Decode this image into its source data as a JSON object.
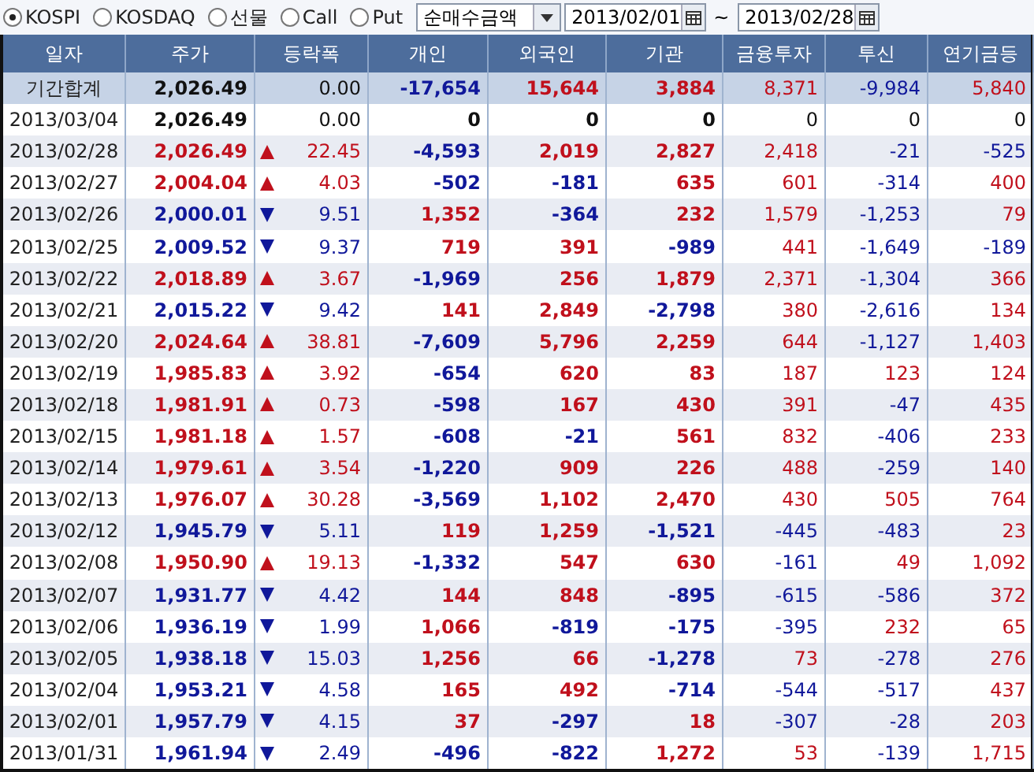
{
  "market_options": [
    {
      "label": "KOSPI",
      "selected": true
    },
    {
      "label": "KOSDAQ",
      "selected": false
    },
    {
      "label": "선물",
      "selected": false
    },
    {
      "label": "Call",
      "selected": false
    },
    {
      "label": "Put",
      "selected": false
    }
  ],
  "measure_select": {
    "value": "순매수금액"
  },
  "date_from": "2013/02/01",
  "range_sep": "~",
  "date_to": "2013/02/28",
  "table": {
    "columns": [
      "일자",
      "주가",
      "등락폭",
      "개인",
      "외국인",
      "기관",
      "금융투자",
      "투신",
      "연기금등"
    ],
    "rows": [
      {
        "date": "기간합계",
        "price": "2,026.49",
        "rising": false,
        "falling": false,
        "change": "0.00",
        "values": [
          "-17,654",
          "15,644",
          "3,884",
          "8,371",
          "-9,984",
          "5,840"
        ],
        "kind": "total"
      },
      {
        "date": "2013/03/04",
        "price": "2,026.49",
        "rising": false,
        "falling": false,
        "change": "0.00",
        "values": [
          "0",
          "0",
          "0",
          "0",
          "0",
          "0"
        ],
        "kind": "day"
      },
      {
        "date": "2013/02/28",
        "price": "2,026.49",
        "rising": true,
        "falling": false,
        "change": "22.45",
        "values": [
          "-4,593",
          "2,019",
          "2,827",
          "2,418",
          "-21",
          "-525"
        ],
        "kind": "day"
      },
      {
        "date": "2013/02/27",
        "price": "2,004.04",
        "rising": true,
        "falling": false,
        "change": "4.03",
        "values": [
          "-502",
          "-181",
          "635",
          "601",
          "-314",
          "400"
        ],
        "kind": "day"
      },
      {
        "date": "2013/02/26",
        "price": "2,000.01",
        "rising": false,
        "falling": true,
        "change": "9.51",
        "values": [
          "1,352",
          "-364",
          "232",
          "1,579",
          "-1,253",
          "79"
        ],
        "kind": "day"
      },
      {
        "date": "2013/02/25",
        "price": "2,009.52",
        "rising": false,
        "falling": true,
        "change": "9.37",
        "values": [
          "719",
          "391",
          "-989",
          "441",
          "-1,649",
          "-189"
        ],
        "kind": "day"
      },
      {
        "date": "2013/02/22",
        "price": "2,018.89",
        "rising": true,
        "falling": false,
        "change": "3.67",
        "values": [
          "-1,969",
          "256",
          "1,879",
          "2,371",
          "-1,304",
          "366"
        ],
        "kind": "day"
      },
      {
        "date": "2013/02/21",
        "price": "2,015.22",
        "rising": false,
        "falling": true,
        "change": "9.42",
        "values": [
          "141",
          "2,849",
          "-2,798",
          "380",
          "-2,616",
          "134"
        ],
        "kind": "day"
      },
      {
        "date": "2013/02/20",
        "price": "2,024.64",
        "rising": true,
        "falling": false,
        "change": "38.81",
        "values": [
          "-7,609",
          "5,796",
          "2,259",
          "644",
          "-1,127",
          "1,403"
        ],
        "kind": "day"
      },
      {
        "date": "2013/02/19",
        "price": "1,985.83",
        "rising": true,
        "falling": false,
        "change": "3.92",
        "values": [
          "-654",
          "620",
          "83",
          "187",
          "123",
          "124"
        ],
        "kind": "day"
      },
      {
        "date": "2013/02/18",
        "price": "1,981.91",
        "rising": true,
        "falling": false,
        "change": "0.73",
        "values": [
          "-598",
          "167",
          "430",
          "391",
          "-47",
          "435"
        ],
        "kind": "day"
      },
      {
        "date": "2013/02/15",
        "price": "1,981.18",
        "rising": true,
        "falling": false,
        "change": "1.57",
        "values": [
          "-608",
          "-21",
          "561",
          "832",
          "-406",
          "233"
        ],
        "kind": "day"
      },
      {
        "date": "2013/02/14",
        "price": "1,979.61",
        "rising": true,
        "falling": false,
        "change": "3.54",
        "values": [
          "-1,220",
          "909",
          "226",
          "488",
          "-259",
          "140"
        ],
        "kind": "day"
      },
      {
        "date": "2013/02/13",
        "price": "1,976.07",
        "rising": true,
        "falling": false,
        "change": "30.28",
        "values": [
          "-3,569",
          "1,102",
          "2,470",
          "430",
          "505",
          "764"
        ],
        "kind": "day"
      },
      {
        "date": "2013/02/12",
        "price": "1,945.79",
        "rising": false,
        "falling": true,
        "change": "5.11",
        "values": [
          "119",
          "1,259",
          "-1,521",
          "-445",
          "-483",
          "23"
        ],
        "kind": "day"
      },
      {
        "date": "2013/02/08",
        "price": "1,950.90",
        "rising": true,
        "falling": false,
        "change": "19.13",
        "values": [
          "-1,332",
          "547",
          "630",
          "-161",
          "49",
          "1,092"
        ],
        "kind": "day"
      },
      {
        "date": "2013/02/07",
        "price": "1,931.77",
        "rising": false,
        "falling": true,
        "change": "4.42",
        "values": [
          "144",
          "848",
          "-895",
          "-615",
          "-586",
          "372"
        ],
        "kind": "day"
      },
      {
        "date": "2013/02/06",
        "price": "1,936.19",
        "rising": false,
        "falling": true,
        "change": "1.99",
        "values": [
          "1,066",
          "-819",
          "-175",
          "-395",
          "232",
          "65"
        ],
        "kind": "day"
      },
      {
        "date": "2013/02/05",
        "price": "1,938.18",
        "rising": false,
        "falling": true,
        "change": "15.03",
        "values": [
          "1,256",
          "66",
          "-1,278",
          "73",
          "-278",
          "276"
        ],
        "kind": "day"
      },
      {
        "date": "2013/02/04",
        "price": "1,953.21",
        "rising": false,
        "falling": true,
        "change": "4.58",
        "values": [
          "165",
          "492",
          "-714",
          "-544",
          "-517",
          "437"
        ],
        "kind": "day"
      },
      {
        "date": "2013/02/01",
        "price": "1,957.79",
        "rising": false,
        "falling": true,
        "change": "4.15",
        "values": [
          "37",
          "-297",
          "18",
          "-307",
          "-28",
          "203"
        ],
        "kind": "day"
      },
      {
        "date": "2013/01/31",
        "price": "1,961.94",
        "rising": false,
        "falling": true,
        "change": "2.49",
        "values": [
          "-496",
          "-822",
          "1,272",
          "53",
          "-139",
          "1,715"
        ],
        "kind": "day"
      }
    ]
  }
}
